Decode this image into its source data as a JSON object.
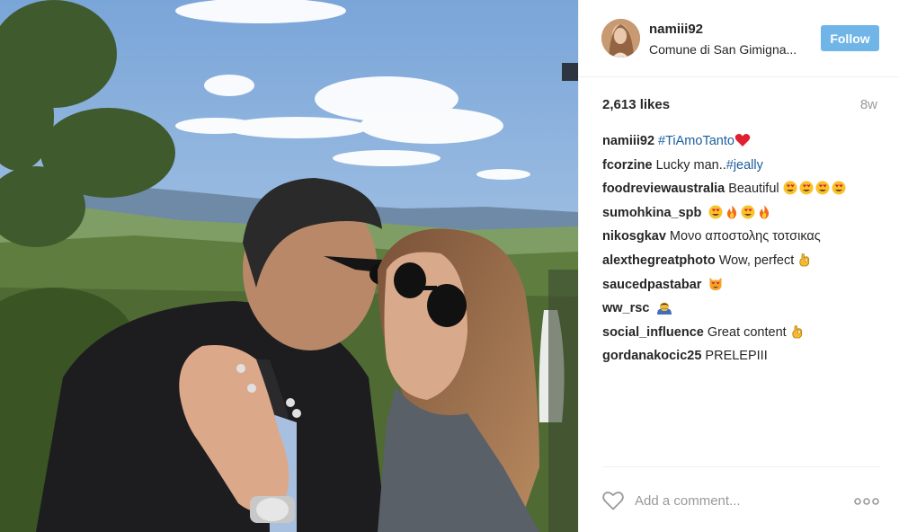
{
  "post": {
    "username": "namiii92",
    "location": "Comune di San Gimigna...",
    "follow_label": "Follow",
    "likes": "2,613 likes",
    "time_ago": "8w",
    "photo_icon": "photo",
    "colors": {
      "follow_button": "#70b5e8",
      "hashtag": "#1a5e9c",
      "text": "#262626",
      "muted": "#999999",
      "divider": "#efefef"
    }
  },
  "comments": [
    {
      "user": "namiii92",
      "text": "",
      "hashtag": "#TiAmoTanto",
      "emoji": [
        "red-heart"
      ]
    },
    {
      "user": "fcorzine",
      "text": "Lucky man..",
      "hashtag": "#jeally",
      "emoji": []
    },
    {
      "user": "foodreviewaustralia",
      "text": "Beautiful",
      "hashtag": "",
      "emoji": [
        "heart-eyes",
        "heart-eyes",
        "heart-eyes",
        "heart-eyes"
      ]
    },
    {
      "user": "sumohkina_spb",
      "text": "",
      "hashtag": "",
      "emoji": [
        "heart-eyes",
        "fire",
        "heart-eyes",
        "fire"
      ]
    },
    {
      "user": "nikosgkav",
      "text": "Μονο αποστολης τοτσικας",
      "hashtag": "",
      "emoji": []
    },
    {
      "user": "alexthegreatphoto",
      "text": "Wow, perfect",
      "hashtag": "",
      "emoji": [
        "ok-hand"
      ]
    },
    {
      "user": "saucedpastabar",
      "text": "",
      "hashtag": "",
      "emoji": [
        "heart-eyes-cat"
      ]
    },
    {
      "user": "ww_rsc",
      "text": "",
      "hashtag": "",
      "emoji": [
        "bowing-person"
      ]
    },
    {
      "user": "social_influence",
      "text": "Great content",
      "hashtag": "",
      "emoji": [
        "ok-hand"
      ]
    },
    {
      "user": "gordanakocic25",
      "text": "PRELEPIII",
      "hashtag": "",
      "emoji": []
    }
  ],
  "footer": {
    "comment_placeholder": "Add a comment...",
    "like_icon": "heart-outline",
    "more_icon": "more-options"
  }
}
